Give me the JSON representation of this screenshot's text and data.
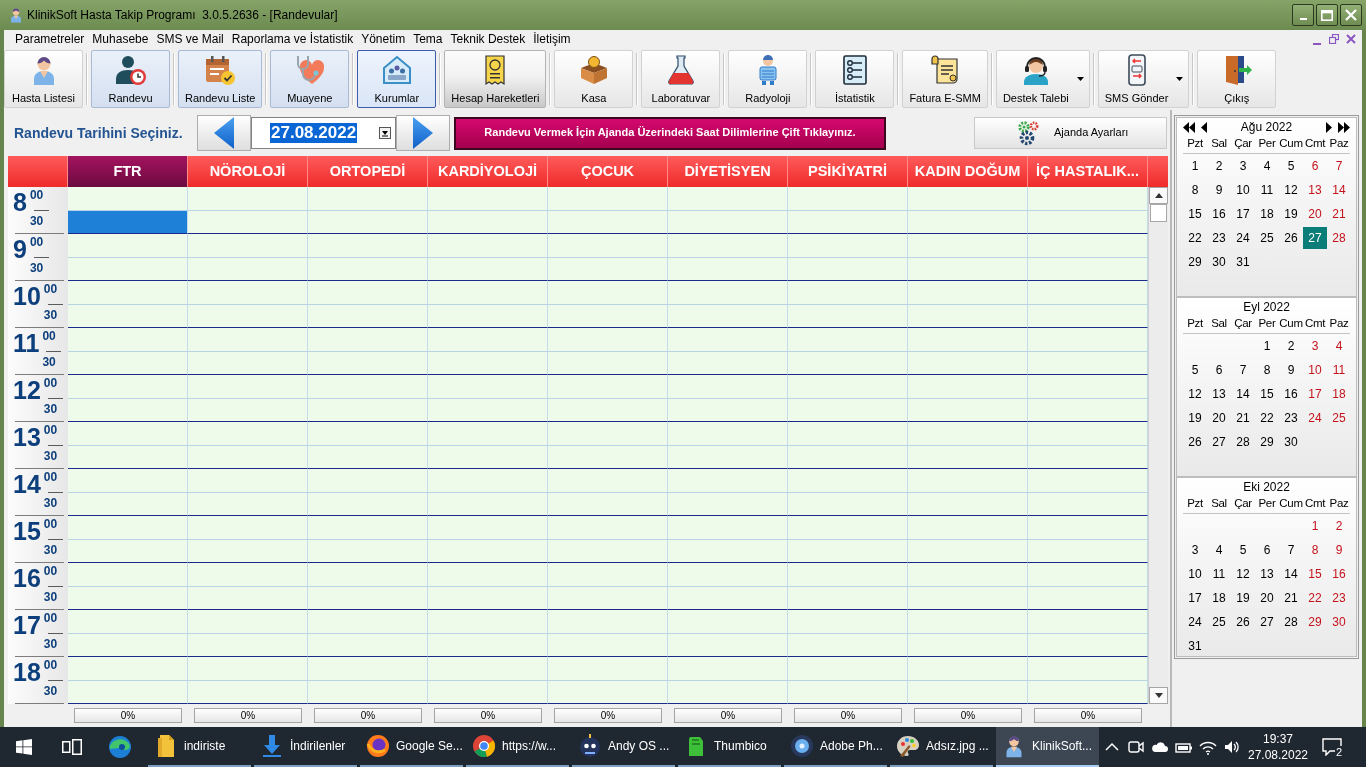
{
  "window": {
    "title": "KlinikSoft Hasta Takip Programı  3.0.5.2636 - [Randevular]"
  },
  "menu": [
    "Parametreler",
    "Muhasebe",
    "SMS ve Mail",
    "Raporlama ve İstatistik",
    "Yönetim",
    "Tema",
    "Teknik Destek",
    "İletişim"
  ],
  "toolbar": [
    {
      "label": "Hasta Listesi",
      "checked": false,
      "focused": false,
      "pressed": false,
      "dropdown": false
    },
    {
      "label": "Randevu",
      "checked": true,
      "focused": false,
      "pressed": false,
      "dropdown": false
    },
    {
      "label": "Randevu Liste",
      "checked": true,
      "focused": false,
      "pressed": false,
      "dropdown": false
    },
    {
      "label": "Muayene",
      "checked": true,
      "focused": false,
      "pressed": false,
      "dropdown": false
    },
    {
      "label": "Kurumlar",
      "checked": true,
      "focused": true,
      "pressed": false,
      "dropdown": false
    },
    {
      "label": "Hesap Hareketleri",
      "checked": false,
      "focused": false,
      "pressed": true,
      "dropdown": false
    },
    {
      "label": "Kasa",
      "checked": false,
      "focused": false,
      "pressed": false,
      "dropdown": false
    },
    {
      "label": "Laboratuvar",
      "checked": false,
      "focused": false,
      "pressed": false,
      "dropdown": false
    },
    {
      "label": "Radyoloji",
      "checked": false,
      "focused": false,
      "pressed": false,
      "dropdown": false
    },
    {
      "label": "İstatistik",
      "checked": false,
      "focused": false,
      "pressed": false,
      "dropdown": false
    },
    {
      "label": "Fatura E-SMM",
      "checked": false,
      "focused": false,
      "pressed": false,
      "dropdown": false
    },
    {
      "label": "Destek Talebi",
      "checked": false,
      "focused": false,
      "pressed": false,
      "dropdown": true
    },
    {
      "label": "SMS Gönder",
      "checked": false,
      "focused": false,
      "pressed": false,
      "dropdown": true
    },
    {
      "label": "Çıkış",
      "checked": false,
      "focused": false,
      "pressed": false,
      "dropdown": false
    }
  ],
  "date_bar": {
    "label": "Randevu Tarihini Seçiniz.",
    "date": "27.08.2022",
    "date_selected": true,
    "notice": "Randevu Vermek İçin Ajanda Üzerindeki Saat Dilimlerine Çift Tıklayınız.",
    "settings_button": "Ajanda Ayarları"
  },
  "schedule": {
    "columns": [
      {
        "name": "FTR",
        "selected": true,
        "occupancy": "0%"
      },
      {
        "name": "NÖROLOJİ",
        "selected": false,
        "occupancy": "0%"
      },
      {
        "name": "ORTOPEDİ",
        "selected": false,
        "occupancy": "0%"
      },
      {
        "name": "KARDİYOLOJİ",
        "selected": false,
        "occupancy": "0%"
      },
      {
        "name": "ÇOCUK",
        "selected": false,
        "occupancy": "0%"
      },
      {
        "name": "DİYETİSYEN",
        "selected": false,
        "occupancy": "0%"
      },
      {
        "name": "PSİKİYATRİ",
        "selected": false,
        "occupancy": "0%"
      },
      {
        "name": "KADIN DOĞUM",
        "selected": false,
        "occupancy": "0%"
      },
      {
        "name": "İÇ HASTALIK...",
        "selected": false,
        "occupancy": "0%"
      }
    ],
    "hours": [
      {
        "hour": "8",
        "slots": [
          {
            "minute": "00",
            "cells": [
              {
                "selected": false
              },
              {
                "selected": false
              },
              {
                "selected": false
              },
              {
                "selected": false
              },
              {
                "selected": false
              },
              {
                "selected": false
              },
              {
                "selected": false
              },
              {
                "selected": false
              },
              {
                "selected": false
              }
            ]
          },
          {
            "minute": "30",
            "cells": [
              {
                "selected": true
              },
              {
                "selected": false
              },
              {
                "selected": false
              },
              {
                "selected": false
              },
              {
                "selected": false
              },
              {
                "selected": false
              },
              {
                "selected": false
              },
              {
                "selected": false
              },
              {
                "selected": false
              }
            ]
          }
        ]
      },
      {
        "hour": "9",
        "slots": [
          {
            "minute": "00",
            "cells": [
              {
                "selected": false
              },
              {
                "selected": false
              },
              {
                "selected": false
              },
              {
                "selected": false
              },
              {
                "selected": false
              },
              {
                "selected": false
              },
              {
                "selected": false
              },
              {
                "selected": false
              },
              {
                "selected": false
              }
            ]
          },
          {
            "minute": "30",
            "cells": [
              {
                "selected": false
              },
              {
                "selected": false
              },
              {
                "selected": false
              },
              {
                "selected": false
              },
              {
                "selected": false
              },
              {
                "selected": false
              },
              {
                "selected": false
              },
              {
                "selected": false
              },
              {
                "selected": false
              }
            ]
          }
        ]
      },
      {
        "hour": "10",
        "slots": [
          {
            "minute": "00",
            "cells": [
              {
                "selected": false
              },
              {
                "selected": false
              },
              {
                "selected": false
              },
              {
                "selected": false
              },
              {
                "selected": false
              },
              {
                "selected": false
              },
              {
                "selected": false
              },
              {
                "selected": false
              },
              {
                "selected": false
              }
            ]
          },
          {
            "minute": "30",
            "cells": [
              {
                "selected": false
              },
              {
                "selected": false
              },
              {
                "selected": false
              },
              {
                "selected": false
              },
              {
                "selected": false
              },
              {
                "selected": false
              },
              {
                "selected": false
              },
              {
                "selected": false
              },
              {
                "selected": false
              }
            ]
          }
        ]
      },
      {
        "hour": "11",
        "slots": [
          {
            "minute": "00",
            "cells": [
              {
                "selected": false
              },
              {
                "selected": false
              },
              {
                "selected": false
              },
              {
                "selected": false
              },
              {
                "selected": false
              },
              {
                "selected": false
              },
              {
                "selected": false
              },
              {
                "selected": false
              },
              {
                "selected": false
              }
            ]
          },
          {
            "minute": "30",
            "cells": [
              {
                "selected": false
              },
              {
                "selected": false
              },
              {
                "selected": false
              },
              {
                "selected": false
              },
              {
                "selected": false
              },
              {
                "selected": false
              },
              {
                "selected": false
              },
              {
                "selected": false
              },
              {
                "selected": false
              }
            ]
          }
        ]
      },
      {
        "hour": "12",
        "slots": [
          {
            "minute": "00",
            "cells": [
              {
                "selected": false
              },
              {
                "selected": false
              },
              {
                "selected": false
              },
              {
                "selected": false
              },
              {
                "selected": false
              },
              {
                "selected": false
              },
              {
                "selected": false
              },
              {
                "selected": false
              },
              {
                "selected": false
              }
            ]
          },
          {
            "minute": "30",
            "cells": [
              {
                "selected": false
              },
              {
                "selected": false
              },
              {
                "selected": false
              },
              {
                "selected": false
              },
              {
                "selected": false
              },
              {
                "selected": false
              },
              {
                "selected": false
              },
              {
                "selected": false
              },
              {
                "selected": false
              }
            ]
          }
        ]
      },
      {
        "hour": "13",
        "slots": [
          {
            "minute": "00",
            "cells": [
              {
                "selected": false
              },
              {
                "selected": false
              },
              {
                "selected": false
              },
              {
                "selected": false
              },
              {
                "selected": false
              },
              {
                "selected": false
              },
              {
                "selected": false
              },
              {
                "selected": false
              },
              {
                "selected": false
              }
            ]
          },
          {
            "minute": "30",
            "cells": [
              {
                "selected": false
              },
              {
                "selected": false
              },
              {
                "selected": false
              },
              {
                "selected": false
              },
              {
                "selected": false
              },
              {
                "selected": false
              },
              {
                "selected": false
              },
              {
                "selected": false
              },
              {
                "selected": false
              }
            ]
          }
        ]
      },
      {
        "hour": "14",
        "slots": [
          {
            "minute": "00",
            "cells": [
              {
                "selected": false
              },
              {
                "selected": false
              },
              {
                "selected": false
              },
              {
                "selected": false
              },
              {
                "selected": false
              },
              {
                "selected": false
              },
              {
                "selected": false
              },
              {
                "selected": false
              },
              {
                "selected": false
              }
            ]
          },
          {
            "minute": "30",
            "cells": [
              {
                "selected": false
              },
              {
                "selected": false
              },
              {
                "selected": false
              },
              {
                "selected": false
              },
              {
                "selected": false
              },
              {
                "selected": false
              },
              {
                "selected": false
              },
              {
                "selected": false
              },
              {
                "selected": false
              }
            ]
          }
        ]
      },
      {
        "hour": "15",
        "slots": [
          {
            "minute": "00",
            "cells": [
              {
                "selected": false
              },
              {
                "selected": false
              },
              {
                "selected": false
              },
              {
                "selected": false
              },
              {
                "selected": false
              },
              {
                "selected": false
              },
              {
                "selected": false
              },
              {
                "selected": false
              },
              {
                "selected": false
              }
            ]
          },
          {
            "minute": "30",
            "cells": [
              {
                "selected": false
              },
              {
                "selected": false
              },
              {
                "selected": false
              },
              {
                "selected": false
              },
              {
                "selected": false
              },
              {
                "selected": false
              },
              {
                "selected": false
              },
              {
                "selected": false
              },
              {
                "selected": false
              }
            ]
          }
        ]
      },
      {
        "hour": "16",
        "slots": [
          {
            "minute": "00",
            "cells": [
              {
                "selected": false
              },
              {
                "selected": false
              },
              {
                "selected": false
              },
              {
                "selected": false
              },
              {
                "selected": false
              },
              {
                "selected": false
              },
              {
                "selected": false
              },
              {
                "selected": false
              },
              {
                "selected": false
              }
            ]
          },
          {
            "minute": "30",
            "cells": [
              {
                "selected": false
              },
              {
                "selected": false
              },
              {
                "selected": false
              },
              {
                "selected": false
              },
              {
                "selected": false
              },
              {
                "selected": false
              },
              {
                "selected": false
              },
              {
                "selected": false
              },
              {
                "selected": false
              }
            ]
          }
        ]
      },
      {
        "hour": "17",
        "slots": [
          {
            "minute": "00",
            "cells": [
              {
                "selected": false
              },
              {
                "selected": false
              },
              {
                "selected": false
              },
              {
                "selected": false
              },
              {
                "selected": false
              },
              {
                "selected": false
              },
              {
                "selected": false
              },
              {
                "selected": false
              },
              {
                "selected": false
              }
            ]
          },
          {
            "minute": "30",
            "cells": [
              {
                "selected": false
              },
              {
                "selected": false
              },
              {
                "selected": false
              },
              {
                "selected": false
              },
              {
                "selected": false
              },
              {
                "selected": false
              },
              {
                "selected": false
              },
              {
                "selected": false
              },
              {
                "selected": false
              }
            ]
          }
        ]
      },
      {
        "hour": "18",
        "slots": [
          {
            "minute": "00",
            "cells": [
              {
                "selected": false
              },
              {
                "selected": false
              },
              {
                "selected": false
              },
              {
                "selected": false
              },
              {
                "selected": false
              },
              {
                "selected": false
              },
              {
                "selected": false
              },
              {
                "selected": false
              },
              {
                "selected": false
              }
            ]
          },
          {
            "minute": "30",
            "cells": [
              {
                "selected": false
              },
              {
                "selected": false
              },
              {
                "selected": false
              },
              {
                "selected": false
              },
              {
                "selected": false
              },
              {
                "selected": false
              },
              {
                "selected": false
              },
              {
                "selected": false
              },
              {
                "selected": false
              }
            ]
          }
        ]
      }
    ]
  },
  "calendar": {
    "months": [
      {
        "title": "Ağu 2022",
        "navigation": true,
        "weekdays": [
          "Pzt",
          "Sal",
          "Çar",
          "Per",
          "Cum",
          "Cmt",
          "Paz"
        ],
        "weeks": [
          {
            "days": [
              {
                "day": "1",
                "selected": false
              },
              {
                "day": "2",
                "selected": false
              },
              {
                "day": "3",
                "selected": false
              },
              {
                "day": "4",
                "selected": false
              },
              {
                "day": "5",
                "selected": false
              },
              {
                "day": "6",
                "selected": false
              },
              {
                "day": "7",
                "selected": false
              }
            ]
          },
          {
            "days": [
              {
                "day": "8",
                "selected": false
              },
              {
                "day": "9",
                "selected": false
              },
              {
                "day": "10",
                "selected": false
              },
              {
                "day": "11",
                "selected": false
              },
              {
                "day": "12",
                "selected": false
              },
              {
                "day": "13",
                "selected": false
              },
              {
                "day": "14",
                "selected": false
              }
            ]
          },
          {
            "days": [
              {
                "day": "15",
                "selected": false
              },
              {
                "day": "16",
                "selected": false
              },
              {
                "day": "17",
                "selected": false
              },
              {
                "day": "18",
                "selected": false
              },
              {
                "day": "19",
                "selected": false
              },
              {
                "day": "20",
                "selected": false
              },
              {
                "day": "21",
                "selected": false
              }
            ]
          },
          {
            "days": [
              {
                "day": "22",
                "selected": false
              },
              {
                "day": "23",
                "selected": false
              },
              {
                "day": "24",
                "selected": false
              },
              {
                "day": "25",
                "selected": false
              },
              {
                "day": "26",
                "selected": false
              },
              {
                "day": "27",
                "selected": true
              },
              {
                "day": "28",
                "selected": false
              }
            ]
          },
          {
            "align_end": false,
            "days": [
              {
                "day": "29",
                "selected": false
              },
              {
                "day": "30",
                "selected": false
              },
              {
                "day": "31",
                "selected": false
              }
            ]
          }
        ]
      },
      {
        "title": "Eyl 2022",
        "navigation": false,
        "weekdays": [
          "Pzt",
          "Sal",
          "Çar",
          "Per",
          "Cum",
          "Cmt",
          "Paz"
        ],
        "weeks": [
          {
            "align_end": true,
            "days": [
              {
                "day": "1",
                "selected": false
              },
              {
                "day": "2",
                "selected": false
              },
              {
                "day": "3",
                "selected": false
              },
              {
                "day": "4",
                "selected": false
              }
            ]
          },
          {
            "days": [
              {
                "day": "5",
                "selected": false
              },
              {
                "day": "6",
                "selected": false
              },
              {
                "day": "7",
                "selected": false
              },
              {
                "day": "8",
                "selected": false
              },
              {
                "day": "9",
                "selected": false
              },
              {
                "day": "10",
                "selected": false
              },
              {
                "day": "11",
                "selected": false
              }
            ]
          },
          {
            "days": [
              {
                "day": "12",
                "selected": false
              },
              {
                "day": "13",
                "selected": false
              },
              {
                "day": "14",
                "selected": false
              },
              {
                "day": "15",
                "selected": false
              },
              {
                "day": "16",
                "selected": false
              },
              {
                "day": "17",
                "selected": false
              },
              {
                "day": "18",
                "selected": false
              }
            ]
          },
          {
            "days": [
              {
                "day": "19",
                "selected": false
              },
              {
                "day": "20",
                "selected": false
              },
              {
                "day": "21",
                "selected": false
              },
              {
                "day": "22",
                "selected": false
              },
              {
                "day": "23",
                "selected": false
              },
              {
                "day": "24",
                "selected": false
              },
              {
                "day": "25",
                "selected": false
              }
            ]
          },
          {
            "align_end": false,
            "days": [
              {
                "day": "26",
                "selected": false
              },
              {
                "day": "27",
                "selected": false
              },
              {
                "day": "28",
                "selected": false
              },
              {
                "day": "29",
                "selected": false
              },
              {
                "day": "30",
                "selected": false
              }
            ]
          }
        ]
      },
      {
        "title": "Eki 2022",
        "navigation": false,
        "weekdays": [
          "Pzt",
          "Sal",
          "Çar",
          "Per",
          "Cum",
          "Cmt",
          "Paz"
        ],
        "weeks": [
          {
            "align_end": true,
            "days": [
              {
                "day": "1",
                "selected": false
              },
              {
                "day": "2",
                "selected": false
              }
            ]
          },
          {
            "days": [
              {
                "day": "3",
                "selected": false
              },
              {
                "day": "4",
                "selected": false
              },
              {
                "day": "5",
                "selected": false
              },
              {
                "day": "6",
                "selected": false
              },
              {
                "day": "7",
                "selected": false
              },
              {
                "day": "8",
                "selected": false
              },
              {
                "day": "9",
                "selected": false
              }
            ]
          },
          {
            "days": [
              {
                "day": "10",
                "selected": false
              },
              {
                "day": "11",
                "selected": false
              },
              {
                "day": "12",
                "selected": false
              },
              {
                "day": "13",
                "selected": false
              },
              {
                "day": "14",
                "selected": false
              },
              {
                "day": "15",
                "selected": false
              },
              {
                "day": "16",
                "selected": false
              }
            ]
          },
          {
            "days": [
              {
                "day": "17",
                "selected": false
              },
              {
                "day": "18",
                "selected": false
              },
              {
                "day": "19",
                "selected": false
              },
              {
                "day": "20",
                "selected": false
              },
              {
                "day": "21",
                "selected": false
              },
              {
                "day": "22",
                "selected": false
              },
              {
                "day": "23",
                "selected": false
              }
            ]
          },
          {
            "days": [
              {
                "day": "24",
                "selected": false
              },
              {
                "day": "25",
                "selected": false
              },
              {
                "day": "26",
                "selected": false
              },
              {
                "day": "27",
                "selected": false
              },
              {
                "day": "28",
                "selected": false
              },
              {
                "day": "29",
                "selected": false
              },
              {
                "day": "30",
                "selected": false
              }
            ]
          },
          {
            "align_end": false,
            "days": [
              {
                "day": "31",
                "selected": false
              }
            ]
          }
        ]
      }
    ]
  },
  "taskbar": {
    "apps": [
      {
        "label": "indiriste",
        "selected": false
      },
      {
        "label": "İndirilenler",
        "selected": false
      },
      {
        "label": "Google Se...",
        "selected": false
      },
      {
        "label": "https://w...",
        "selected": false
      },
      {
        "label": "Andy OS ...",
        "selected": false
      },
      {
        "label": "Thumbico",
        "selected": false
      },
      {
        "label": "Adobe Ph...",
        "selected": false
      },
      {
        "label": "Adsız.jpg ...",
        "selected": false
      },
      {
        "label": "KlinikSoft...",
        "selected": true
      }
    ],
    "time": "19:37",
    "date": "27.08.2022",
    "notifications": "2"
  }
}
